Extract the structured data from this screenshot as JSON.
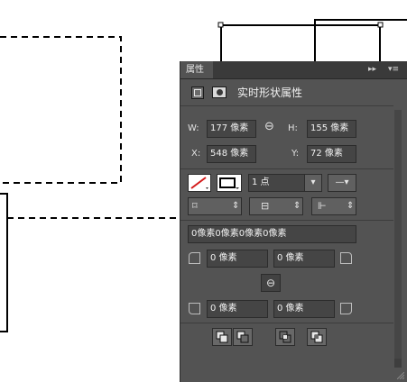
{
  "window": {
    "background": "#ffffff"
  },
  "panel": {
    "tab_label": "属性",
    "collapse_glyph": "▸▸",
    "menu_glyph": "▾≡",
    "header_title": "实时形状属性",
    "dimensions": {
      "w_label": "W:",
      "w_value": "177 像素",
      "h_label": "H:",
      "h_value": "155 像素",
      "x_label": "X:",
      "x_value": "548 像素",
      "y_label": "Y:",
      "y_value": "72 像素",
      "link_glyph": "⊖"
    },
    "stroke": {
      "width_value": "1 点",
      "dropdown_glyph": "▾",
      "line_style_glyph": "—▾"
    },
    "align": {
      "stepper_glyph": "⇕"
    },
    "radius": {
      "all_value": "0像素0像素0像素0像素",
      "top_left": "0 像素",
      "top_right": "0 像素",
      "bottom_left": "0 像素",
      "bottom_right": "0 像素",
      "link_glyph": "⊖"
    },
    "colors": {
      "panel_bg": "#535353",
      "field_bg": "#454545",
      "text": "#e2e2e2"
    }
  }
}
